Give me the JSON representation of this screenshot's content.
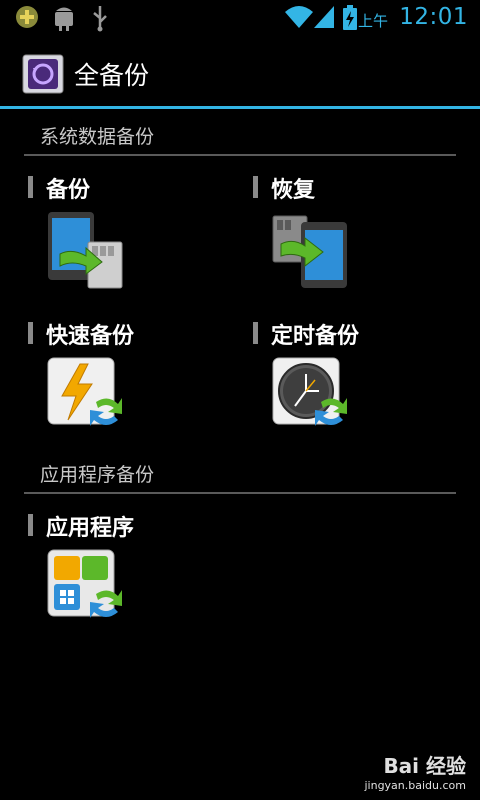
{
  "status_bar": {
    "ampm": "上午",
    "time": "12:01",
    "icons": [
      "plus-circle-icon",
      "android-debug-icon",
      "usb-icon",
      "wifi-icon",
      "signal-icon",
      "battery-charging-icon"
    ]
  },
  "app_bar": {
    "title": "全备份",
    "icon": "backup-app-icon"
  },
  "sections": [
    {
      "header": "系统数据备份",
      "items": [
        {
          "label": "备份",
          "icon": "backup-phone-to-sd-icon"
        },
        {
          "label": "恢复",
          "icon": "restore-sd-to-phone-icon"
        },
        {
          "label": "快速备份",
          "icon": "quick-backup-lightning-icon"
        },
        {
          "label": "定时备份",
          "icon": "scheduled-backup-clock-icon"
        }
      ]
    },
    {
      "header": "应用程序备份",
      "items": [
        {
          "label": "应用程序",
          "icon": "apps-backup-icon"
        }
      ]
    }
  ],
  "watermark": {
    "logo": "Bai 经验",
    "url": "jingyan.baidu.com"
  },
  "colors": {
    "accent": "#33b5e5",
    "background": "#000000"
  }
}
